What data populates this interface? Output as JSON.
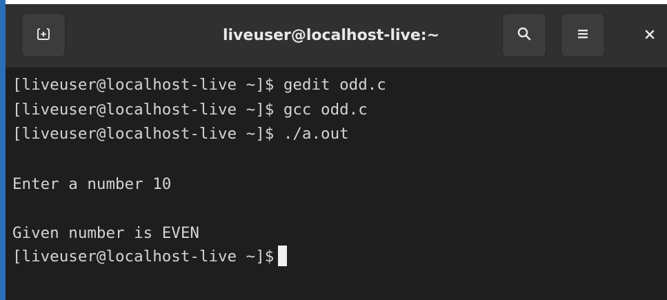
{
  "window": {
    "title": "liveuser@localhost-live:~"
  },
  "header": {
    "new_tab_icon": "new-tab-icon",
    "search_icon": "search-icon",
    "menu_icon": "hamburger-menu-icon",
    "close_icon": "close-icon"
  },
  "colors": {
    "terminal_bg": "#1e1e1e",
    "header_bg": "#303030",
    "text": "#d4d4d4",
    "accent_edge": "#2a6fb8"
  },
  "terminal": {
    "lines": [
      "[liveuser@localhost-live ~]$ gedit odd.c",
      "[liveuser@localhost-live ~]$ gcc odd.c",
      "[liveuser@localhost-live ~]$ ./a.out",
      "Enter a number 10",
      "Given number is EVEN"
    ],
    "prompt": "[liveuser@localhost-live ~]$"
  }
}
